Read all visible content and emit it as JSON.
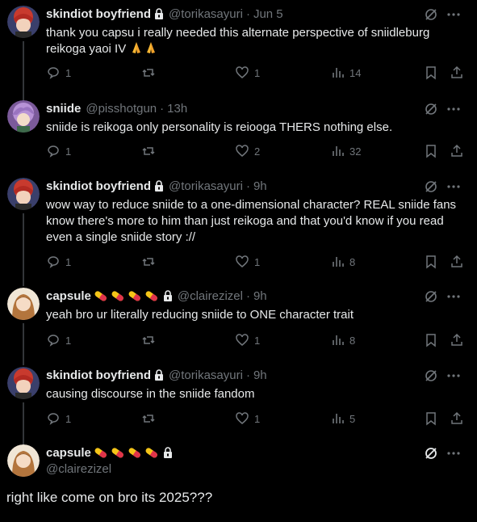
{
  "posts": [
    {
      "name": "skindiot boyfriend",
      "handle": "@torikasayuri",
      "time": "Jun 5",
      "text": "thank you capsu i really needed this alternate perspective of sniidleburg reikoga yaoi IV",
      "stats": {
        "reply": "1",
        "retweet": "",
        "like": "1",
        "views": "14"
      }
    },
    {
      "name": "sniide",
      "handle": "@pisshotgun",
      "time": "13h",
      "text": "sniide is reikoga only personality is reiooga THERS nothing else.",
      "stats": {
        "reply": "1",
        "retweet": "",
        "like": "2",
        "views": "32"
      }
    },
    {
      "name": "skindiot boyfriend",
      "handle": "@torikasayuri",
      "time": "9h",
      "text": "wow way to reduce sniide to a one-dimensional character? REAL sniide fans know there's more to him than just reikoga and that you'd know if you read even a single sniide story ://",
      "stats": {
        "reply": "1",
        "retweet": "",
        "like": "1",
        "views": "8"
      }
    },
    {
      "name": "capsule",
      "handle": "@clairezizel",
      "time": "9h",
      "text": "yeah bro ur literally reducing sniide to ONE character trait",
      "stats": {
        "reply": "1",
        "retweet": "",
        "like": "1",
        "views": "8"
      }
    },
    {
      "name": "skindiot boyfriend",
      "handle": "@torikasayuri",
      "time": "9h",
      "text": "causing discourse in the sniide fandom",
      "stats": {
        "reply": "1",
        "retweet": "",
        "like": "1",
        "views": "5"
      }
    }
  ],
  "main_post": {
    "name": "capsule",
    "handle": "@clairezizel",
    "text": "right like come on bro its 2025???"
  },
  "colors": {
    "background": "#000000",
    "text": "#e7e9ea",
    "muted": "#71767b",
    "thread_line": "#333639"
  },
  "icons": [
    "lock-icon",
    "pill-icon",
    "praying-hands-icon",
    "grok-icon",
    "more-icon",
    "reply-icon",
    "retweet-icon",
    "like-icon",
    "views-icon",
    "bookmark-icon",
    "share-icon"
  ]
}
